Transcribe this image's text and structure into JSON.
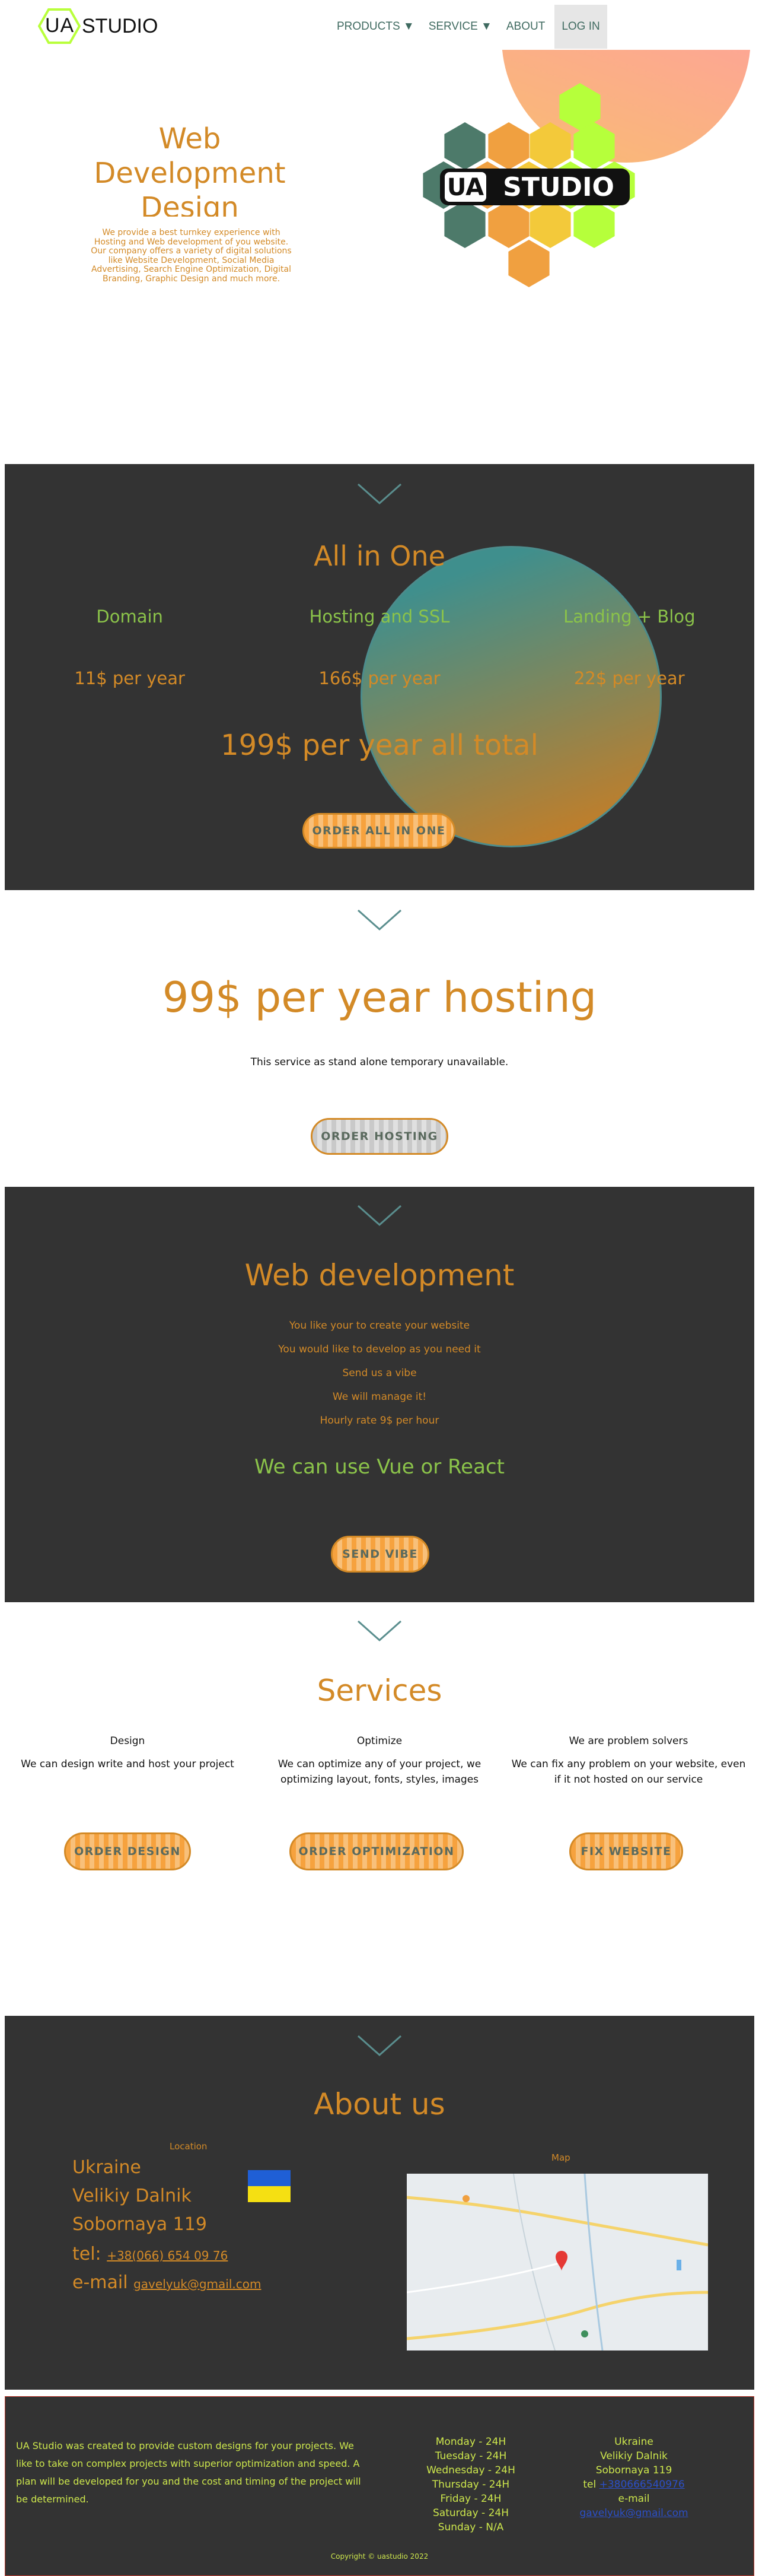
{
  "nav": {
    "logo_ua": "UA",
    "logo_studio": "STUDIO",
    "items": [
      {
        "label": "PRODUCTS ▼"
      },
      {
        "label": "SERVICE ▼"
      },
      {
        "label": "ABOUT"
      },
      {
        "label": "LOG IN"
      }
    ]
  },
  "hero": {
    "title": "Web Development Design",
    "description": "We provide a best turnkey experience with Hosting and Web development of you website. Our company offers a variety of digital solutions like Website Development, Social Media Advertising, Search Engine Optimization, Digital Branding, Graphic Design and much more.",
    "logo_ua": "UA",
    "logo_studio": "STUDIO"
  },
  "allinone": {
    "title": "All in One",
    "items": [
      {
        "name": "Domain",
        "price": "11$ per year"
      },
      {
        "name": "Hosting and SSL",
        "price": "166$ per year"
      },
      {
        "name": "Landing + Blog",
        "price": "22$ per year"
      }
    ],
    "total": "199$ per year all total",
    "button": "ORDER ALL IN ONE"
  },
  "hosting": {
    "title": "99$ per year hosting",
    "note": "This service as stand alone temporary unavailable.",
    "button": "ORDER HOSTING"
  },
  "webdev": {
    "title": "Web development",
    "lines": [
      "You like your to create your website",
      "You would like to develop as you need it",
      "Send us a vibe",
      "We will manage it!",
      "Hourly rate 9$ per hour"
    ],
    "tech": "We can use Vue or React",
    "button": "SEND VIBE"
  },
  "services": {
    "title": "Services",
    "cols": [
      {
        "heading": "Design",
        "text": "We can design write and host your project",
        "button": "ORDER DESIGN"
      },
      {
        "heading": "Optimize",
        "text": "We can optimize any of your project, we optimizing layout, fonts, styles, images",
        "button": "ORDER OPTIMIZATION"
      },
      {
        "heading": "We are problem solvers",
        "text": "We can fix any problem on your website, even if it not hosted on our service",
        "button": "FIX WEBSITE"
      }
    ]
  },
  "about": {
    "title": "About us",
    "location_label": "Location",
    "map_label": "Map",
    "country": "Ukraine",
    "city": "Velikiy Dalnik",
    "street": "Sobornaya 119",
    "tel_label": "tel: ",
    "tel": "+38(066) 654 09 76",
    "email_label": "e-mail ",
    "email": "gavelyuk@gmail.com"
  },
  "footer": {
    "about": "UA Studio was created to provide custom designs for your projects. We like to take on complex projects with superior optimization and speed. A plan will be developed for you and the cost and timing of the project will be determined.",
    "hours": [
      "Monday - 24H",
      "Tuesday - 24H",
      "Wednesday - 24H",
      "Thursday - 24H",
      "Friday - 24H",
      "Saturday - 24H",
      "Sunday - N/A"
    ],
    "contact": [
      "Ukraine",
      "Velikiy Dalnik",
      "Sobornaya 119"
    ],
    "tel_label": "tel",
    "tel_value": "+380666540976",
    "email_label": "e-mail",
    "email_value": "gavelyuk@gmail.com",
    "copyright": "Copyright © uastudio 2022"
  },
  "colors": {
    "accent_orange": "#d38a27",
    "accent_green": "#8bc34a",
    "dark_bg": "#333333",
    "footer_text": "#cde74c"
  }
}
